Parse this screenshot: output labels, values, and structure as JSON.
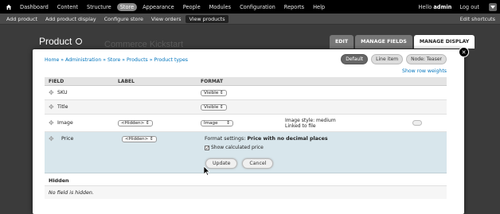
{
  "toolbar": {
    "items": [
      "Dashboard",
      "Content",
      "Structure",
      "Store",
      "Appearance",
      "People",
      "Modules",
      "Configuration",
      "Reports",
      "Help"
    ],
    "active_index": 3,
    "hello_prefix": "Hello ",
    "user": "admin",
    "logout": "Log out"
  },
  "shortcuts": {
    "items": [
      "Add product",
      "Add product display",
      "Configure store",
      "View orders",
      "View products"
    ],
    "active_index": 4,
    "edit": "Edit shortcuts"
  },
  "page": {
    "title": "Product",
    "bg_text": "Commerce Kickstart",
    "tabs": [
      "EDIT",
      "MANAGE FIELDS",
      "MANAGE DISPLAY"
    ],
    "active_tab": 2
  },
  "modal": {
    "breadcrumb": "Home » Administration » Store » Products » Product types",
    "view_modes": [
      "Default",
      "Line item",
      "Node: Teaser"
    ],
    "active_view_mode": 0,
    "show_weights": "Show row weights",
    "headers": [
      "FIELD",
      "LABEL",
      "FORMAT"
    ],
    "rows": {
      "sku": {
        "name": "SKU",
        "format": "Visible"
      },
      "title": {
        "name": "Title",
        "format": "Visible"
      },
      "image": {
        "name": "Image",
        "label": "<Hidden>",
        "format": "Image",
        "summary1": "Image style: medium",
        "summary2": "Linked to file"
      },
      "price": {
        "name": "Price",
        "label": "<Hidden>",
        "settings_prefix": "Format settings: ",
        "settings_value": "Price with no decimal places",
        "checkbox": "Show calculated price",
        "update": "Update",
        "cancel": "Cancel"
      }
    },
    "hidden_title": "Hidden",
    "hidden_empty": "No field is hidden."
  }
}
